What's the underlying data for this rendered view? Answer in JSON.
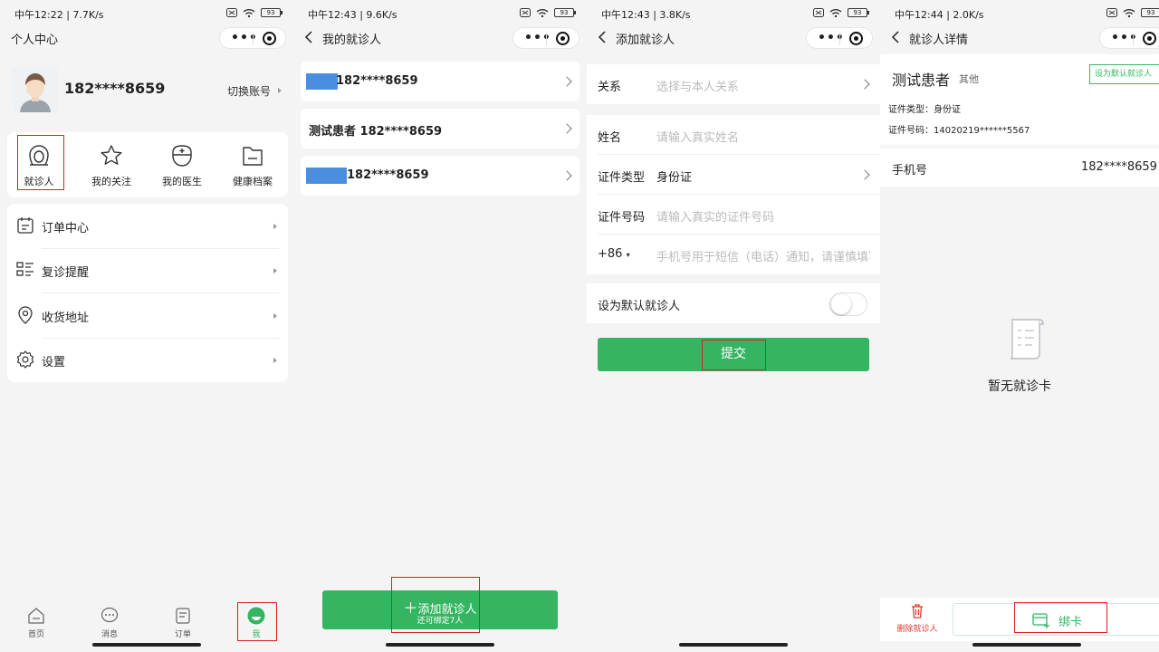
{
  "colors": {
    "accent": "#35b562",
    "danger": "#e03a2e",
    "mask": "#4a8ee0",
    "highlight": "#d92020"
  },
  "screens": [
    {
      "status": {
        "time_speed": "中午12:22 | 7.7K/s",
        "battery": "93"
      },
      "nav": {
        "title": "个人中心"
      },
      "profile": {
        "phone": "182****8659",
        "switch_label": "切换账号"
      },
      "quick": [
        {
          "label": "就诊人",
          "icon": "patient-icon"
        },
        {
          "label": "我的关注",
          "icon": "star-icon"
        },
        {
          "label": "我的医生",
          "icon": "doctor-icon"
        },
        {
          "label": "健康档案",
          "icon": "folder-icon"
        }
      ],
      "menu": [
        {
          "label": "订单中心",
          "icon": "calendar-icon"
        },
        {
          "label": "复诊提醒",
          "icon": "list-icon"
        },
        {
          "label": "收货地址",
          "icon": "location-icon"
        },
        {
          "label": "设置",
          "icon": "settings-icon"
        }
      ],
      "tabs": [
        {
          "label": "首页",
          "icon": "home-icon"
        },
        {
          "label": "消息",
          "icon": "message-icon"
        },
        {
          "label": "订单",
          "icon": "order-icon"
        },
        {
          "label": "我",
          "icon": "me-icon"
        }
      ]
    },
    {
      "status": {
        "time_speed": "中午12:43 | 9.6K/s",
        "battery": "93"
      },
      "nav": {
        "title": "我的就诊人"
      },
      "patients": [
        {
          "text": "182****8659"
        },
        {
          "text": "测试患者 182****8659"
        },
        {
          "text": "182****8659"
        }
      ],
      "add_button": {
        "label": "添加就诊人",
        "sub": "还可绑定7人"
      }
    },
    {
      "status": {
        "time_speed": "中午12:43 | 3.8K/s",
        "battery": "93"
      },
      "nav": {
        "title": "添加就诊人"
      },
      "form": {
        "relation_label": "关系",
        "relation_placeholder": "选择与本人关系",
        "name_label": "姓名",
        "name_placeholder": "请输入真实姓名",
        "idtype_label": "证件类型",
        "idtype_value": "身份证",
        "idno_label": "证件号码",
        "idno_placeholder": "请输入真实的证件号码",
        "phone_prefix": "+86",
        "phone_placeholder": "手机号用于短信（电话）通知，请谨慎填写",
        "default_label": "设为默认就诊人",
        "default_on": false
      },
      "submit_label": "提交"
    },
    {
      "status": {
        "time_speed": "中午12:44 | 2.0K/s",
        "battery": "93"
      },
      "nav": {
        "title": "就诊人详情"
      },
      "detail": {
        "name": "测试患者",
        "tag": "其他",
        "default_button": "设为默认就诊人",
        "id_type": "证件类型：身份证",
        "id_no": "证件号码：14020219******5567",
        "phone_label": "手机号",
        "phone_value": "182****8659"
      },
      "empty_text": "暂无就诊卡",
      "delete_label": "删除就诊人",
      "bind_label": "绑卡"
    }
  ]
}
